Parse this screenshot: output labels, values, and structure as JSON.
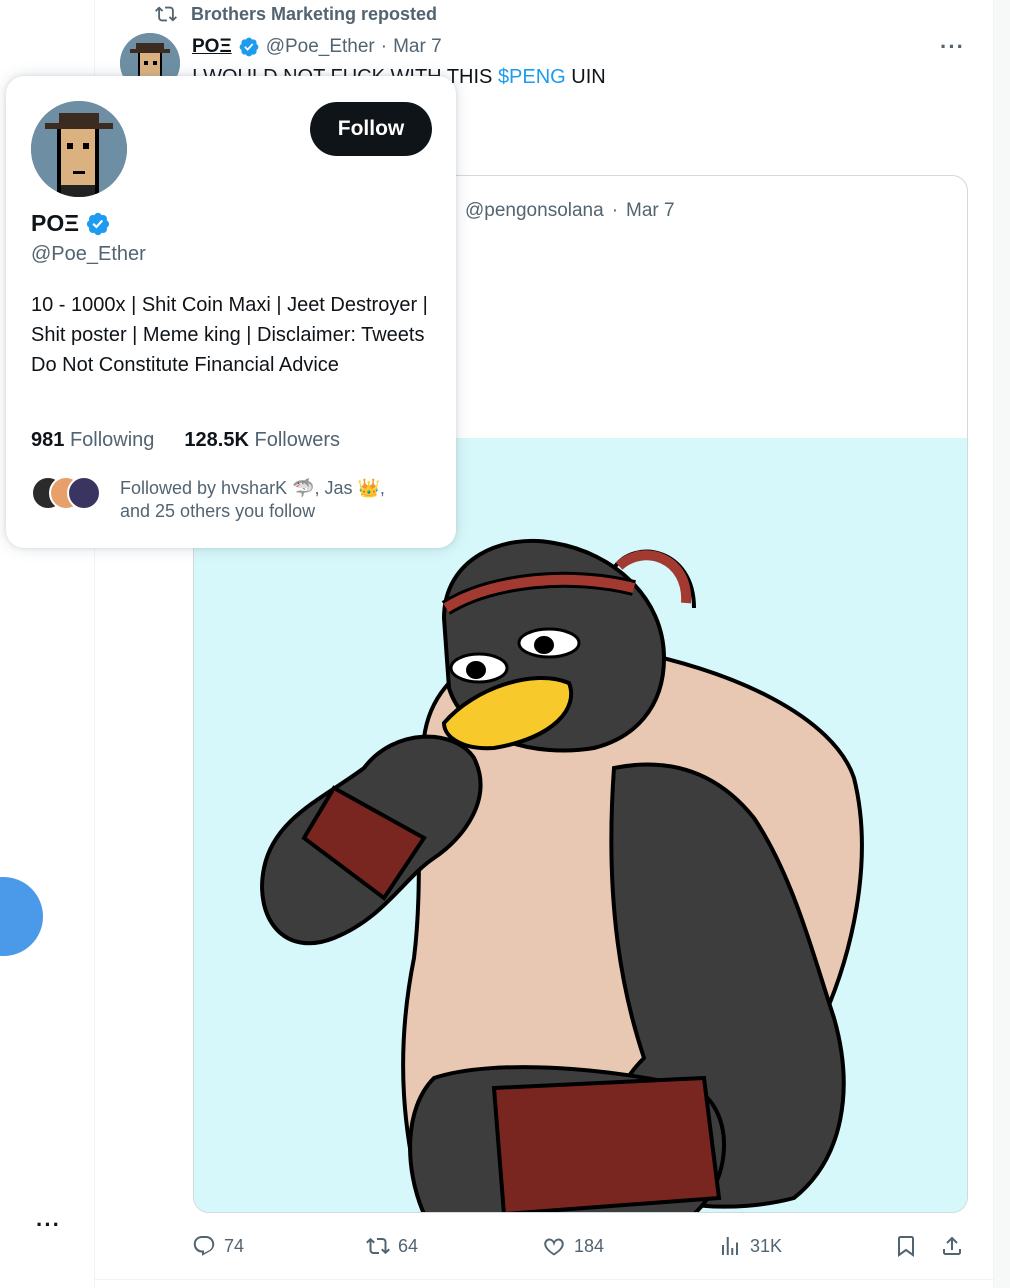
{
  "repost": {
    "text": "Brothers Marketing reposted",
    "icon": "repost-icon"
  },
  "tweet": {
    "author_name": "POΞ",
    "author_handle": "@Poe_Ether",
    "separator": "·",
    "date": "Mar 7",
    "text_prefix": "I WOULD NOT FUCK WITH THIS ",
    "cashtag": "$PENG",
    "text_suffix": " UIN",
    "more": "···"
  },
  "quote": {
    "handle": "@pengonsolana",
    "separator": "·",
    "date": "Mar 7"
  },
  "actions": {
    "replies": "74",
    "reposts": "64",
    "likes": "184",
    "views": "31K"
  },
  "hover_card": {
    "follow_label": "Follow",
    "name": "POΞ",
    "handle": "@Poe_Ether",
    "bio": "10 - 1000x | Shit Coin Maxi | Jeet Destroyer | Shit poster | Meme king | Disclaimer: Tweets Do Not Constitute Financial Advice",
    "following_count": "981",
    "following_label": "Following",
    "followers_count": "128.5K",
    "followers_label": "Followers",
    "followed_by_line1": "Followed by hvsharK 🦈, Jas 👑,",
    "followed_by_line2": "and 25 others you follow"
  },
  "rail": {
    "more": "···"
  },
  "colors": {
    "accent": "#1d9bf0",
    "verified": "#1d9bf0",
    "follow_button": "#0f1419",
    "secondary_text": "#536471",
    "media_background": "#d6f8fa"
  }
}
